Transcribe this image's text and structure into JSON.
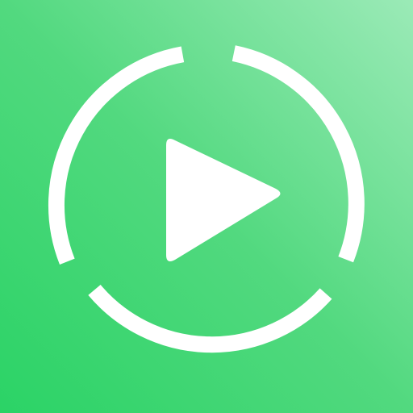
{
  "icon": {
    "name": "play-icon",
    "ring_name": "segmented-ring-icon",
    "colors": {
      "background_start": "#2bd366",
      "background_mid": "#52d97f",
      "background_end": "#9beab7",
      "foreground": "#ffffff"
    }
  }
}
